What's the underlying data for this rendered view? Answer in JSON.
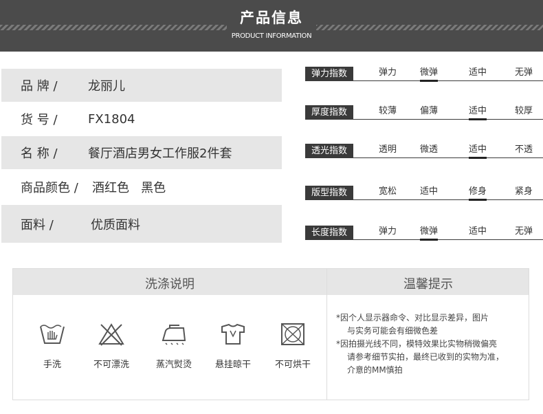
{
  "header": {
    "title": "产品信息",
    "subtitle": "PRODUCT INFORMATION"
  },
  "info": [
    {
      "label": "品 牌 /",
      "value": "龙丽儿",
      "shaded": true
    },
    {
      "label": "货 号 /",
      "value": "FX1804",
      "shaded": false
    },
    {
      "label": "名 称 /",
      "value": "餐厅酒店男女工作服2件套",
      "shaded": true
    },
    {
      "label": "商品颜色 /",
      "value": "酒红色   黑色",
      "shaded": false
    },
    {
      "label": "面料 /",
      "value": "优质面料",
      "shaded": true
    }
  ],
  "indices": [
    {
      "tag": "弹力指数",
      "options": [
        "弹力",
        "微弹",
        "适中",
        "无弹"
      ],
      "selected": 1
    },
    {
      "tag": "厚度指数",
      "options": [
        "较薄",
        "偏薄",
        "适中",
        "较厚"
      ],
      "selected": 2
    },
    {
      "tag": "透光指数",
      "options": [
        "透明",
        "微透",
        "适中",
        "不透"
      ],
      "selected": 2
    },
    {
      "tag": "版型指数",
      "options": [
        "宽松",
        "适中",
        "修身",
        "紧身"
      ],
      "selected": 2
    },
    {
      "tag": "长度指数",
      "options": [
        "弹力",
        "微弹",
        "适中",
        "无弹"
      ],
      "selected": 1
    }
  ],
  "care": {
    "heading": "洗涤说明",
    "items": [
      {
        "label": "手洗",
        "icon": "hand-wash-icon"
      },
      {
        "label": "不可漂洗",
        "icon": "no-bleach-icon"
      },
      {
        "label": "蒸汽熨烫",
        "icon": "steam-iron-icon"
      },
      {
        "label": "悬挂晾干",
        "icon": "hang-dry-icon"
      },
      {
        "label": "不可烘干",
        "icon": "no-tumble-dry-icon"
      }
    ]
  },
  "tips": {
    "heading": "温馨提示",
    "lines": [
      "*因个人显示器命令、对比显示差异，图片",
      "与实务可能会有细微色差",
      "*因拍摄光线不同，模特效果比实物稍微偏亮",
      "请参考细节实拍，最终已收到的实物为准，",
      "介意的MM慎拍"
    ]
  }
}
